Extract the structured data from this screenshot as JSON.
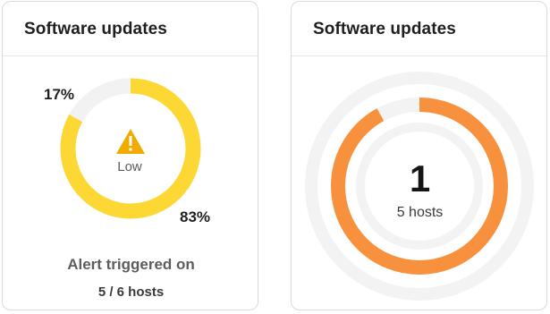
{
  "cards": [
    {
      "title": "Software updates",
      "donut": {
        "low_percent_label": "17%",
        "high_percent_label": "83%",
        "fraction": 0.83
      },
      "status": {
        "icon": "warning-icon",
        "label": "Low"
      },
      "alert_text": "Alert triggered on",
      "hosts_ratio": "5 / 6 hosts",
      "colors": {
        "accent": "#fdd835",
        "track": "#f2f2f2"
      }
    },
    {
      "title": "Software updates",
      "count": "1",
      "hosts_label": "5 hosts",
      "progress_fraction": 0.92,
      "colors": {
        "accent": "#f7913d",
        "track": "#f3f3f3"
      }
    }
  ]
}
